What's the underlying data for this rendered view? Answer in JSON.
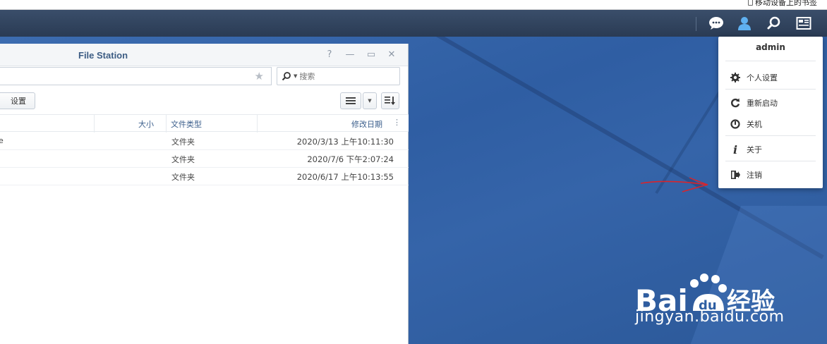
{
  "browser": {
    "bookmark_label": "移动设备上的书签"
  },
  "taskbar": {
    "icons": [
      "chat-icon",
      "user-icon",
      "search-icon",
      "widget-icon"
    ]
  },
  "window": {
    "title": "File Station",
    "controls": {
      "help": "?",
      "minimize": "—",
      "maximize": "▭",
      "close": "✕"
    },
    "search_placeholder": "搜索",
    "settings_label": "设置",
    "columns": {
      "size": "大小",
      "type": "文件类型",
      "date": "修改日期"
    },
    "rows": [
      {
        "name": "e",
        "type": "文件夹",
        "date": "2020/3/13 上午10:11:30"
      },
      {
        "name": "",
        "type": "文件夹",
        "date": "2020/7/6 下午2:07:24"
      },
      {
        "name": "",
        "type": "文件夹",
        "date": "2020/6/17 上午10:13:55"
      }
    ]
  },
  "user_menu": {
    "username": "admin",
    "items": [
      {
        "label": "个人设置",
        "icon": "gear-icon"
      },
      {
        "label": "重新启动",
        "icon": "restart-icon"
      },
      {
        "label": "关机",
        "icon": "power-icon"
      },
      {
        "label": "关于",
        "icon": "info-icon"
      },
      {
        "label": "注销",
        "icon": "logout-icon"
      }
    ]
  },
  "watermark": {
    "brand_latin": "Bai",
    "brand_cn": "经验",
    "url": "jingyan.baidu.com"
  },
  "colors": {
    "taskbar": "#2f4159",
    "accent": "#3d5d84",
    "desktop": "#2f5fa3",
    "annotation": "#d9242b"
  }
}
